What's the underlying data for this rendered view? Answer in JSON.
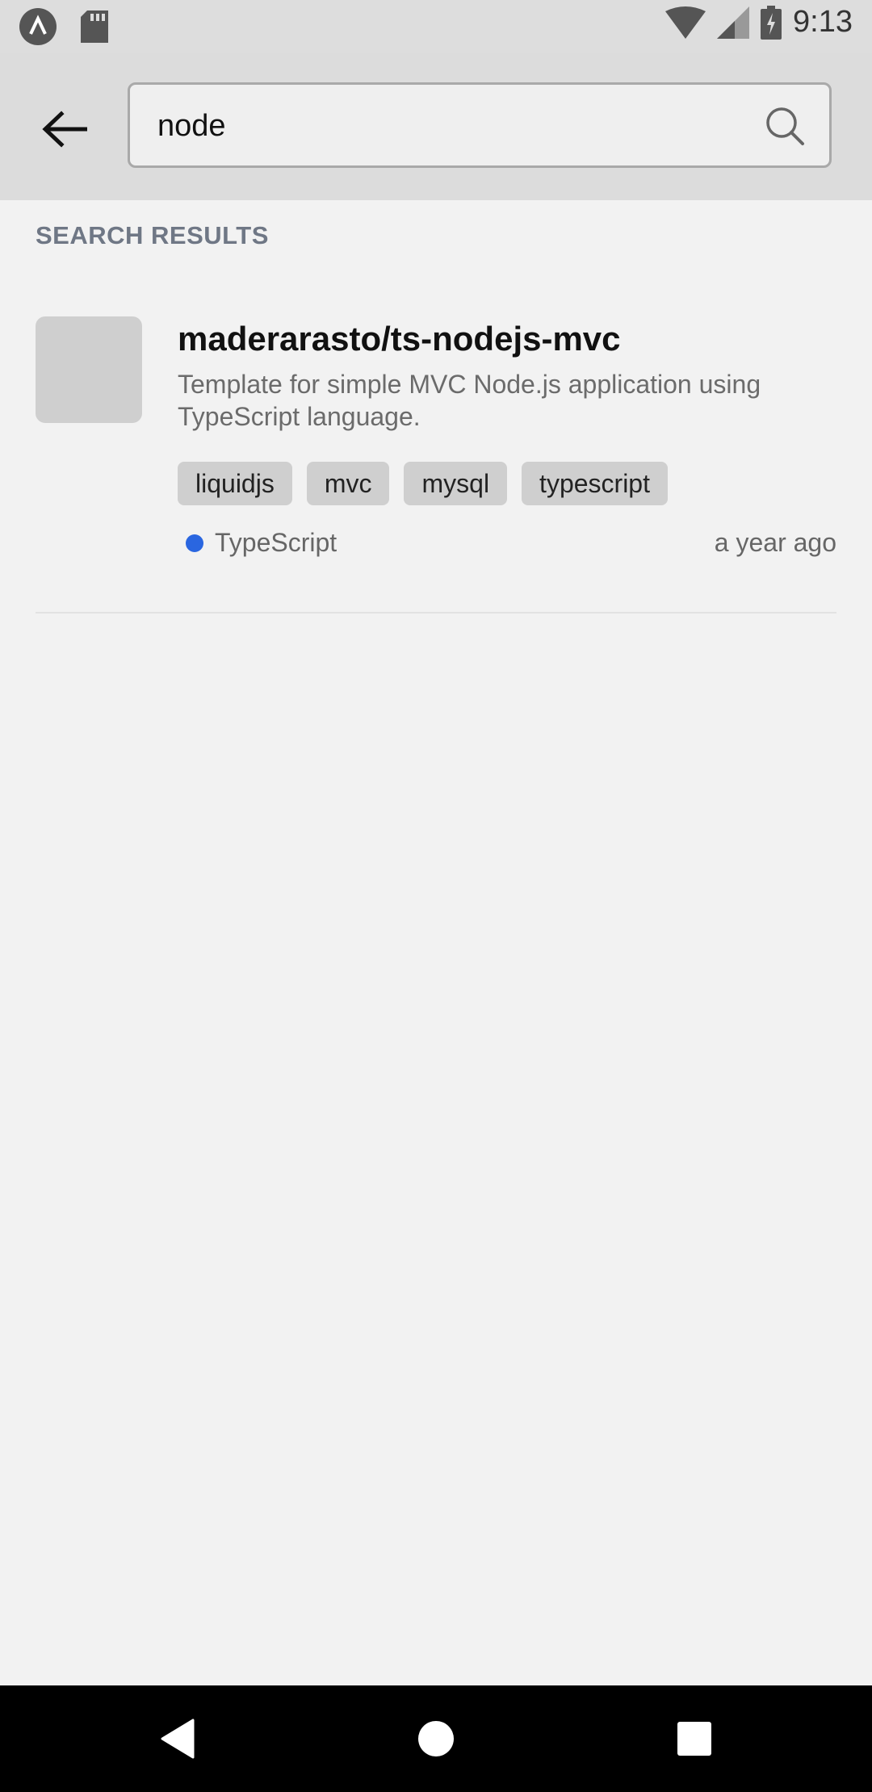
{
  "status_bar": {
    "time": "9:13",
    "icons": [
      "app-logo-icon",
      "sd-card-icon",
      "wifi-icon",
      "signal-icon",
      "battery-charging-icon"
    ]
  },
  "search": {
    "value": "node",
    "placeholder": "Search"
  },
  "section": {
    "title": "SEARCH RESULTS"
  },
  "results": [
    {
      "name": "maderarasto/ts-nodejs-mvc",
      "description": "Template for simple MVC Node.js application using TypeScript language.",
      "tags": [
        "liquidjs",
        "mvc",
        "mysql",
        "typescript"
      ],
      "language": "TypeScript",
      "language_color": "#2a66e0",
      "updated": "a year ago"
    }
  ],
  "nav": {
    "icons": [
      "back-triangle-icon",
      "home-circle-icon",
      "recents-square-icon"
    ]
  }
}
